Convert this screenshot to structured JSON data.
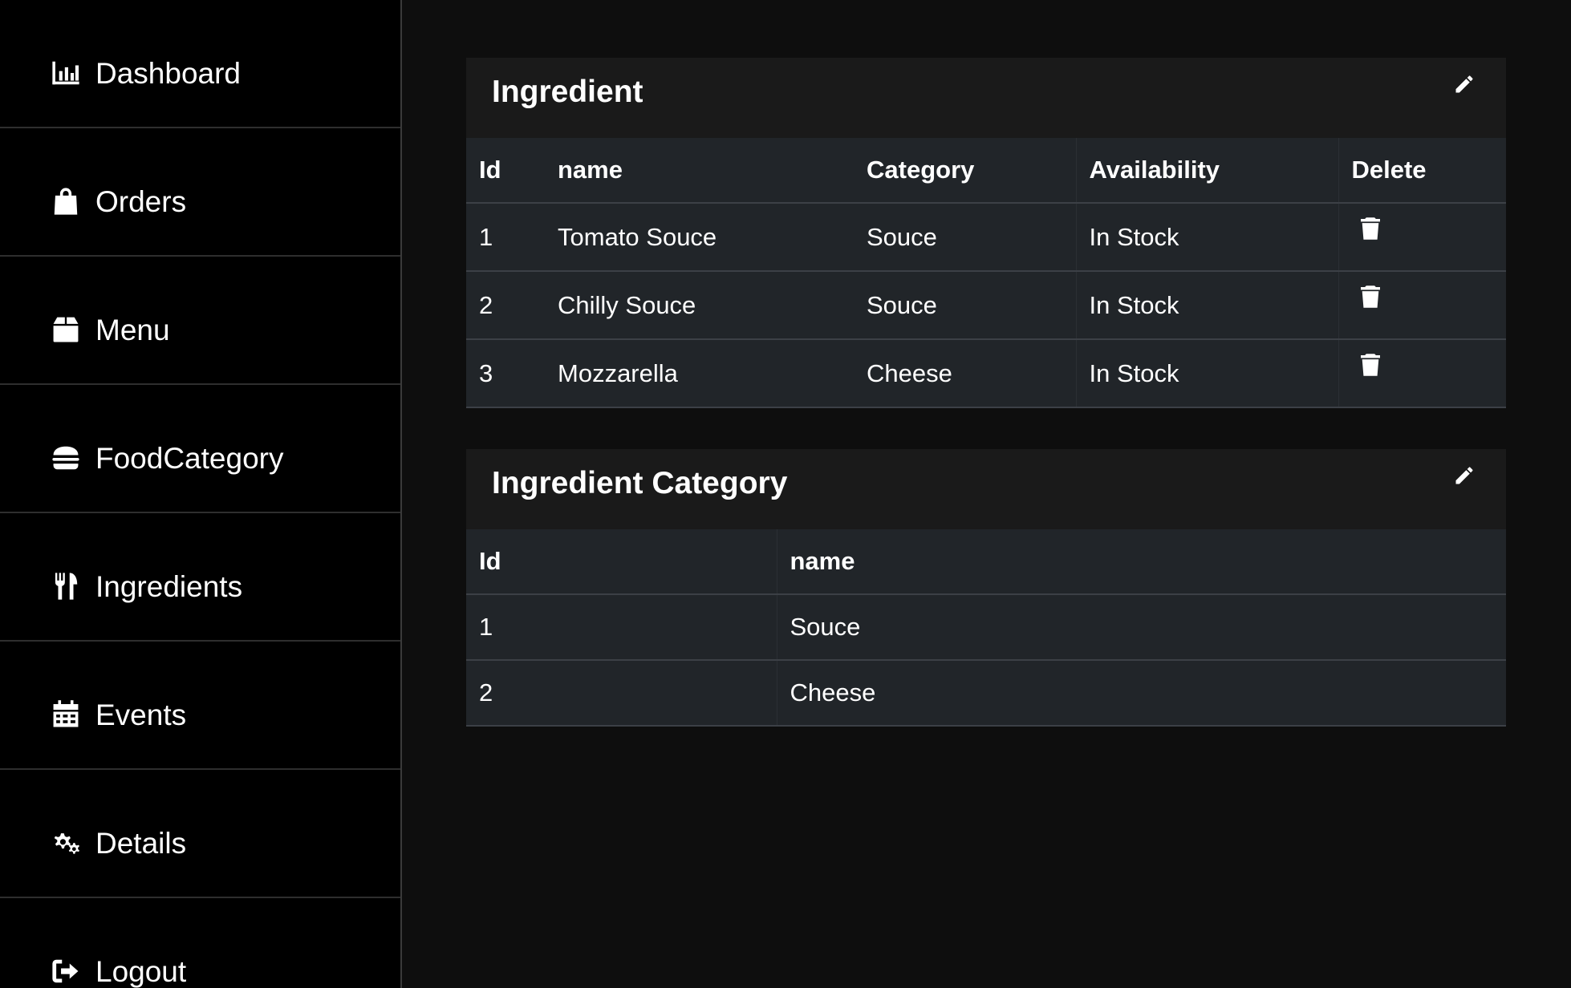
{
  "sidebar": {
    "items": [
      {
        "label": "Dashboard",
        "icon": "chart-bar-icon"
      },
      {
        "label": "Orders",
        "icon": "shopping-bag-icon"
      },
      {
        "label": "Menu",
        "icon": "box-icon"
      },
      {
        "label": "FoodCategory",
        "icon": "hamburger-icon"
      },
      {
        "label": "Ingredients",
        "icon": "utensils-icon"
      },
      {
        "label": "Events",
        "icon": "calendar-icon"
      },
      {
        "label": "Details",
        "icon": "cogs-icon"
      },
      {
        "label": "Logout",
        "icon": "sign-out-icon"
      }
    ]
  },
  "ingredient_card": {
    "title": "Ingredient",
    "edit_icon": "pencil-icon",
    "columns": [
      "Id",
      "name",
      "Category",
      "Availability",
      "Delete"
    ],
    "rows": [
      {
        "id": "1",
        "name": "Tomato Souce",
        "category": "Souce",
        "availability": "In Stock"
      },
      {
        "id": "2",
        "name": "Chilly Souce",
        "category": "Souce",
        "availability": "In Stock"
      },
      {
        "id": "3",
        "name": "Mozzarella",
        "category": "Cheese",
        "availability": "In Stock"
      }
    ],
    "delete_icon": "trash-icon"
  },
  "category_card": {
    "title": "Ingredient Category",
    "edit_icon": "pencil-icon",
    "columns": [
      "Id",
      "name"
    ],
    "rows": [
      {
        "id": "1",
        "name": "Souce"
      },
      {
        "id": "2",
        "name": "Cheese"
      }
    ]
  },
  "colors": {
    "sidebar_bg": "#000000",
    "page_bg": "#0e0e0e",
    "card_header_bg": "#1a1a1a",
    "table_bg": "#212529",
    "text": "#ffffff"
  }
}
